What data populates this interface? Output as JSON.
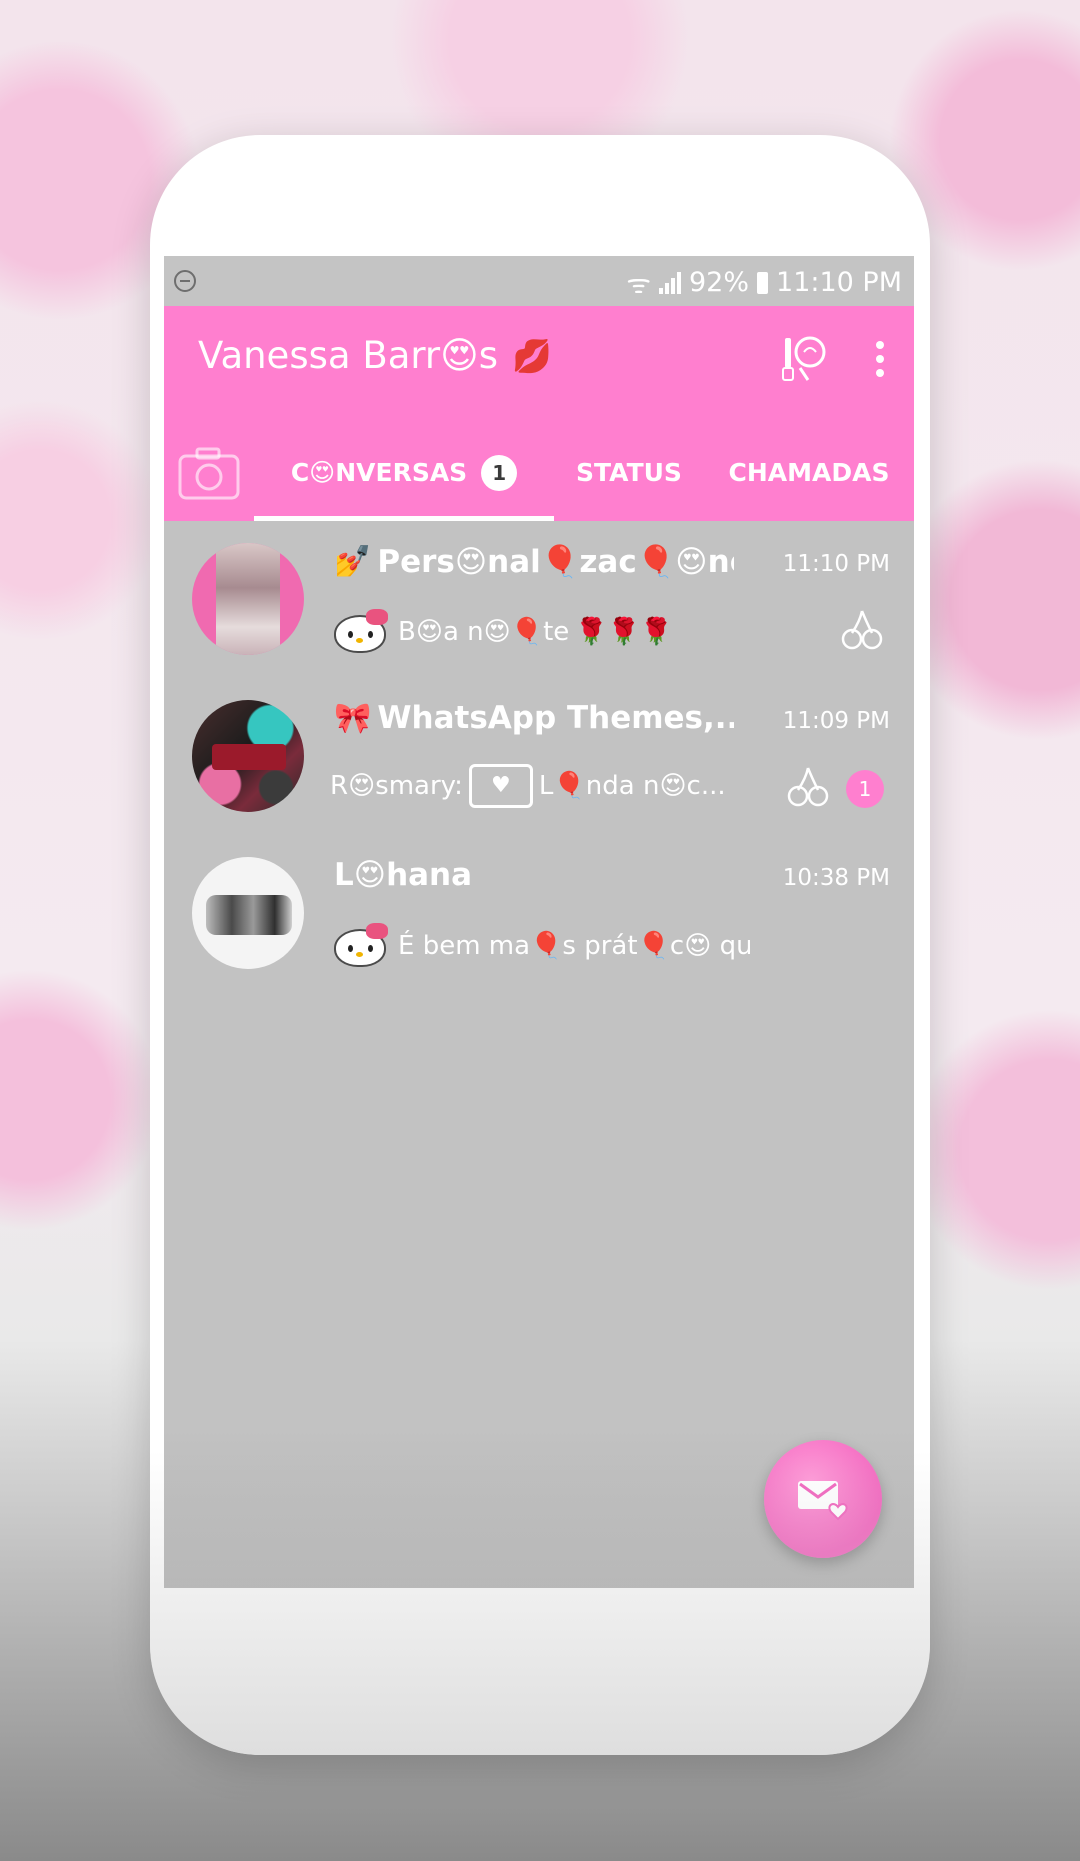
{
  "status_bar": {
    "battery": "92%",
    "time": "11:10 PM"
  },
  "header": {
    "title": "Vanessa Barr😍s",
    "title_emoji": "💋",
    "icons": [
      "customize-tool-icon",
      "more-options-icon"
    ]
  },
  "tabs": [
    {
      "label": "C😍NVERSAS",
      "badge": "1"
    },
    {
      "label": "STATUS"
    },
    {
      "label": "CHAMADAS"
    }
  ],
  "chats": [
    {
      "name": "Pers😍nal🎈zac🎈😍nes...",
      "name_emoji": "💅",
      "time": "11:10 PM",
      "message": "B😍a n😍🎈te",
      "message_prefix_icon": "hello-kitty-icon",
      "message_suffix": "🌹🌹🌹",
      "status_icon": "cherry-icon"
    },
    {
      "name": "WhatsApp Themes,...",
      "name_emoji": "🎀",
      "time": "11:09 PM",
      "sender": "R😍smary:",
      "message": "L🎈nda n😍c...",
      "message_icon": "photo-icon",
      "status_icon": "cherry-icon",
      "unread": "1"
    },
    {
      "name": "L😍hana",
      "time": "10:38 PM",
      "message": "É bem ma🎈s prát🎈c😍 que 😍 n...",
      "message_prefix_icon": "hello-kitty-icon"
    }
  ],
  "fab": {
    "icon": "new-message-icon"
  },
  "colors": {
    "accent": "#ff7fcf",
    "list_background": "#c2c2c2",
    "text": "#ffffff"
  }
}
